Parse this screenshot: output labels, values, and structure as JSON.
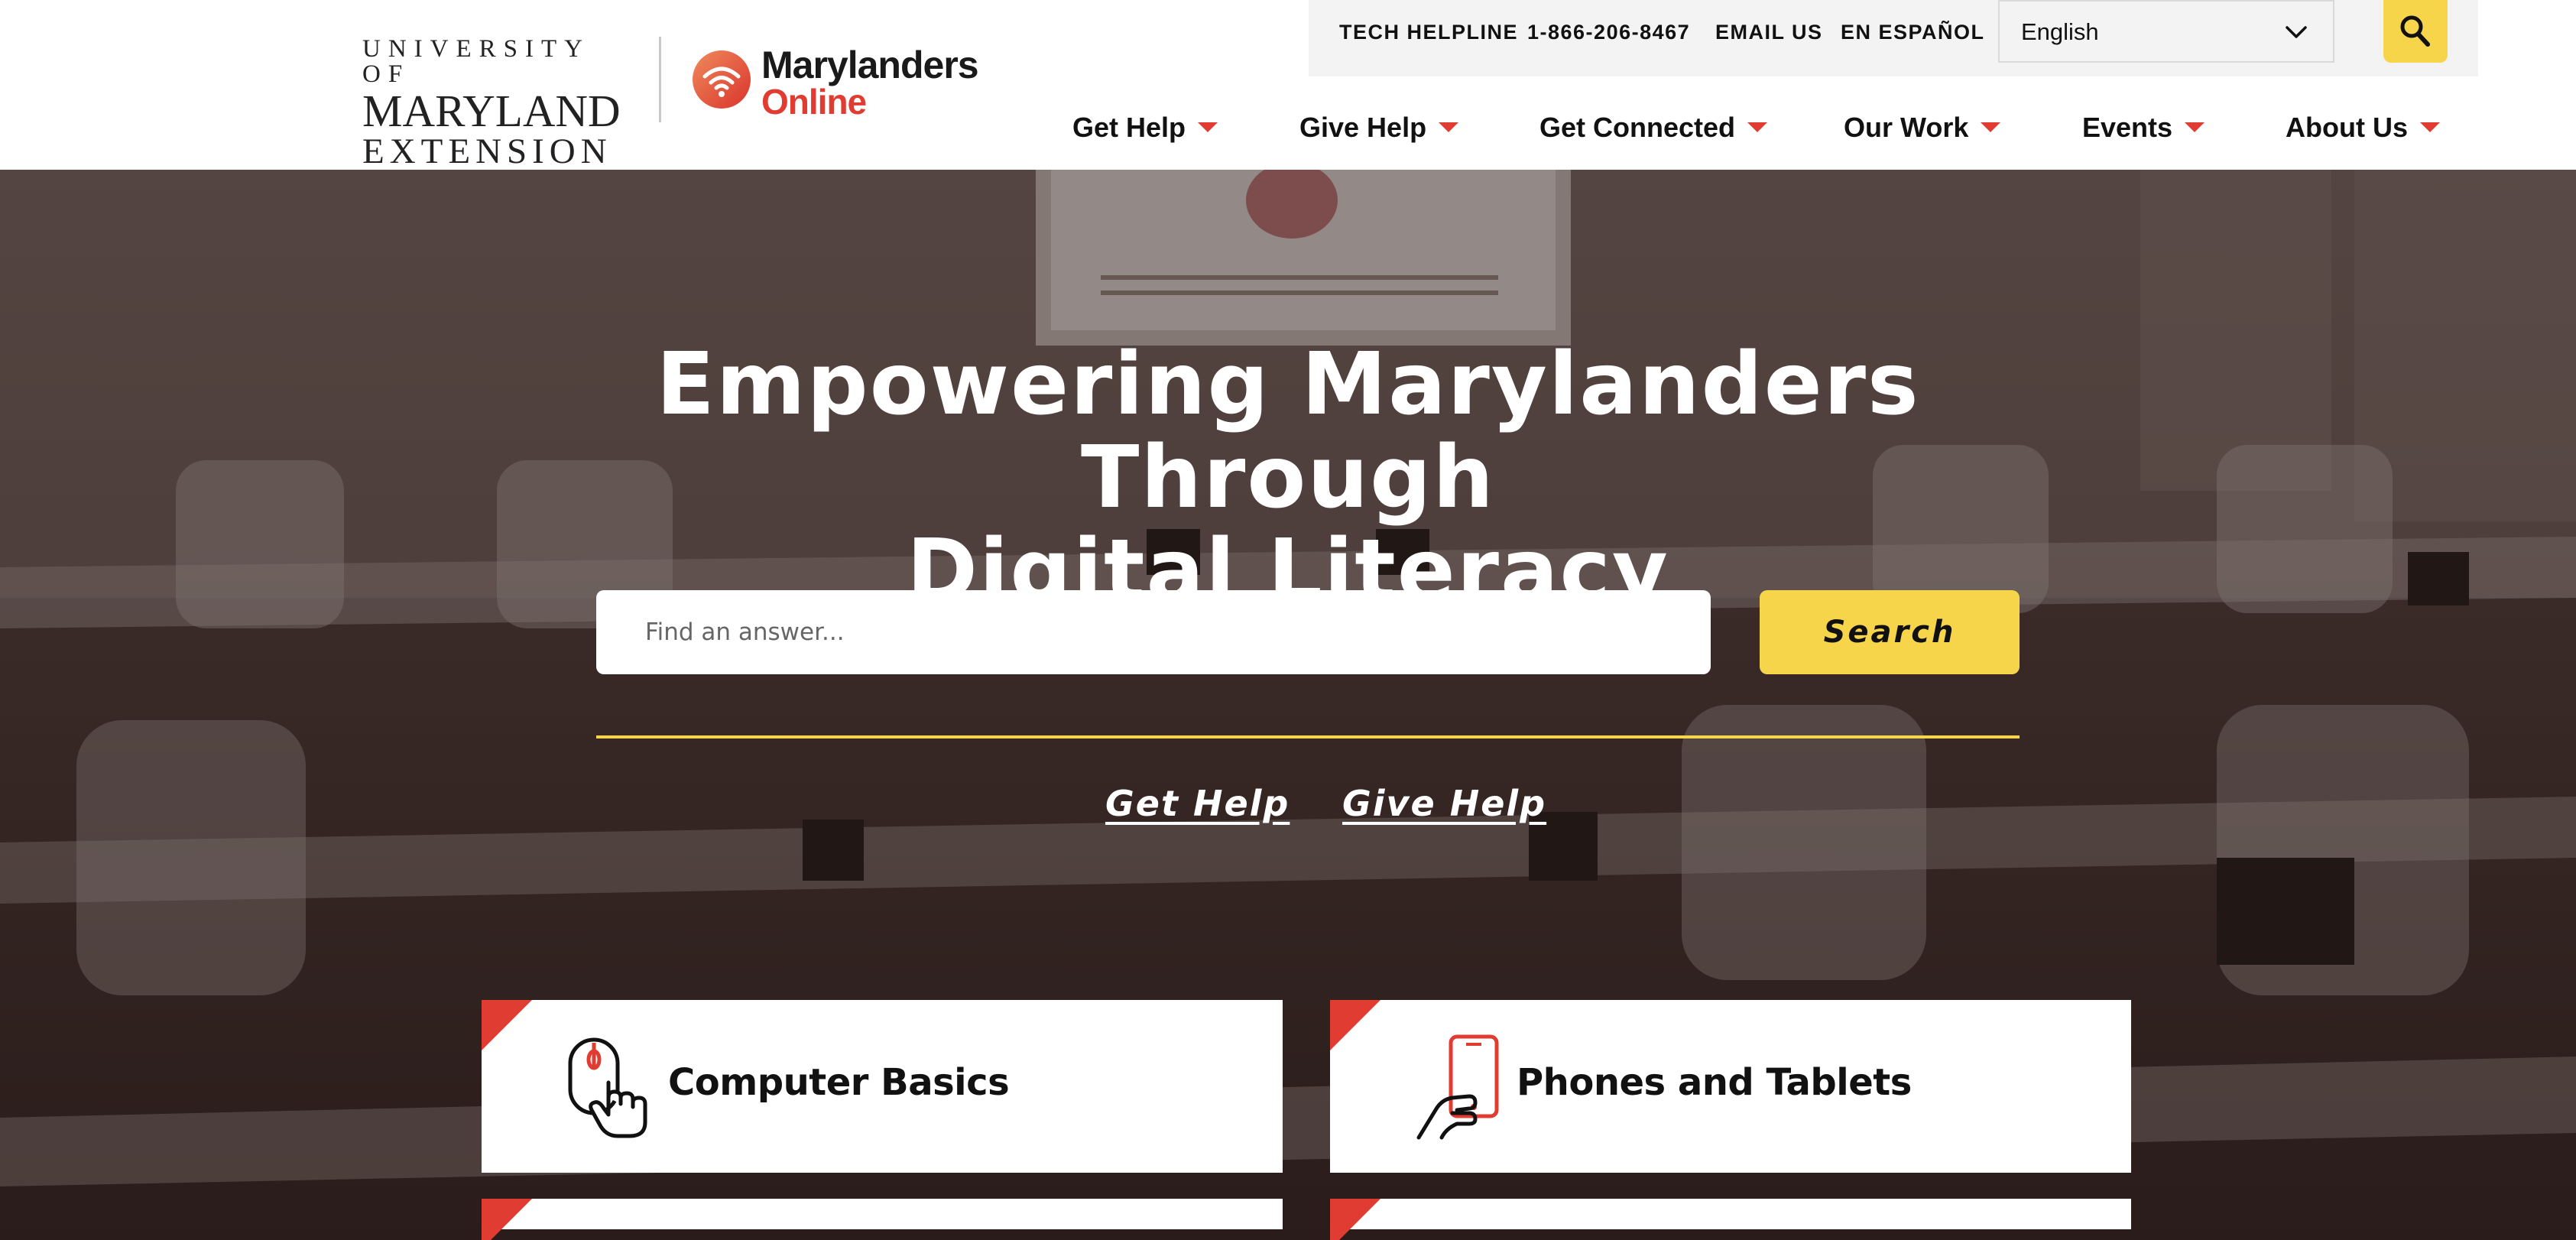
{
  "branding": {
    "umd_line1": "UNIVERSITY OF",
    "umd_line2": "MARYLAND",
    "umd_line3": "EXTENSION",
    "site_name_line1": "Marylanders",
    "site_name_line2": "Online",
    "accent_color": "#e03c31",
    "highlight_color": "#f7d54a"
  },
  "utility": {
    "tech_helpline": "TECH HELPLINE",
    "phone": "1-866-206-8467",
    "email": "EMAIL US",
    "spanish": "EN ESPAÑOL",
    "language_selected": "English",
    "search_icon": "search-icon",
    "chevron_icon": "chevron-down-icon"
  },
  "nav": {
    "items": [
      {
        "label": "Get Help"
      },
      {
        "label": "Give Help"
      },
      {
        "label": "Get Connected"
      },
      {
        "label": "Our Work"
      },
      {
        "label": "Events"
      },
      {
        "label": "About Us"
      }
    ]
  },
  "hero": {
    "title_line1": "Empowering Marylanders Through",
    "title_line2": "Digital Literacy",
    "search_placeholder": "Find an answer...",
    "search_button": "Search",
    "link_get_help": "Get Help",
    "link_give_help": "Give Help"
  },
  "cards": [
    {
      "title": "Computer Basics",
      "icon": "computer-mouse-hand-icon"
    },
    {
      "title": "Phones and Tablets",
      "icon": "phone-hand-icon"
    }
  ]
}
